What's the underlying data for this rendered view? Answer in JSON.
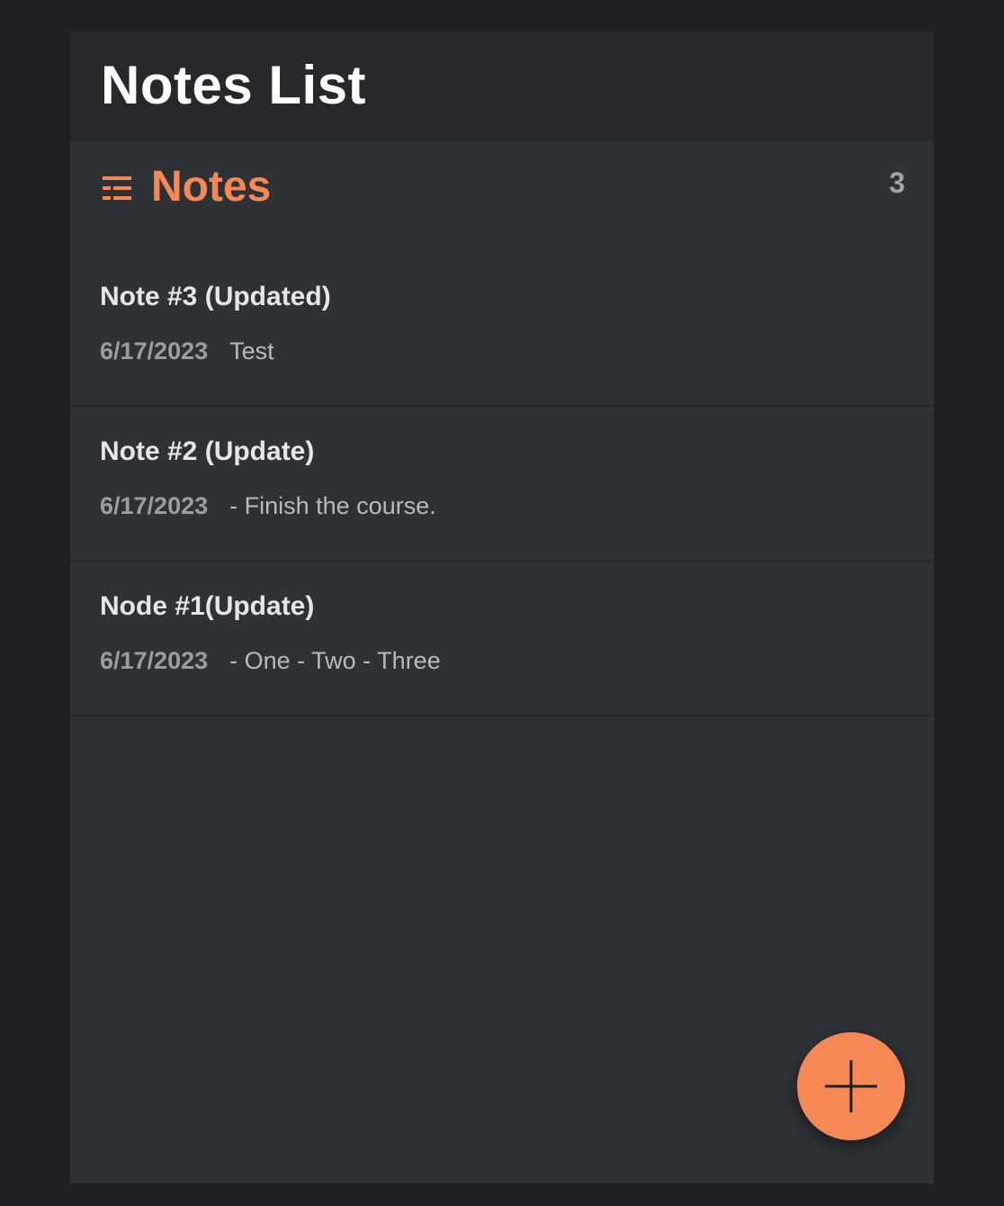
{
  "header": {
    "title": "Notes List"
  },
  "section": {
    "icon": "list-icon",
    "title": "Notes",
    "count": "3"
  },
  "notes": [
    {
      "title": "Note #3 (Updated)",
      "date": "6/17/2023",
      "excerpt": "Test"
    },
    {
      "title": "Note #2 (Update)",
      "date": "6/17/2023",
      "excerpt": "- Finish the course."
    },
    {
      "title": "Node #1(Update)",
      "date": "6/17/2023",
      "excerpt": "- One - Two - Three"
    }
  ],
  "fab": {
    "icon": "plus-icon"
  },
  "colors": {
    "accent": "#f58855",
    "background": "#1f2023",
    "panel": "#2e3135",
    "topbar": "#27282b"
  }
}
